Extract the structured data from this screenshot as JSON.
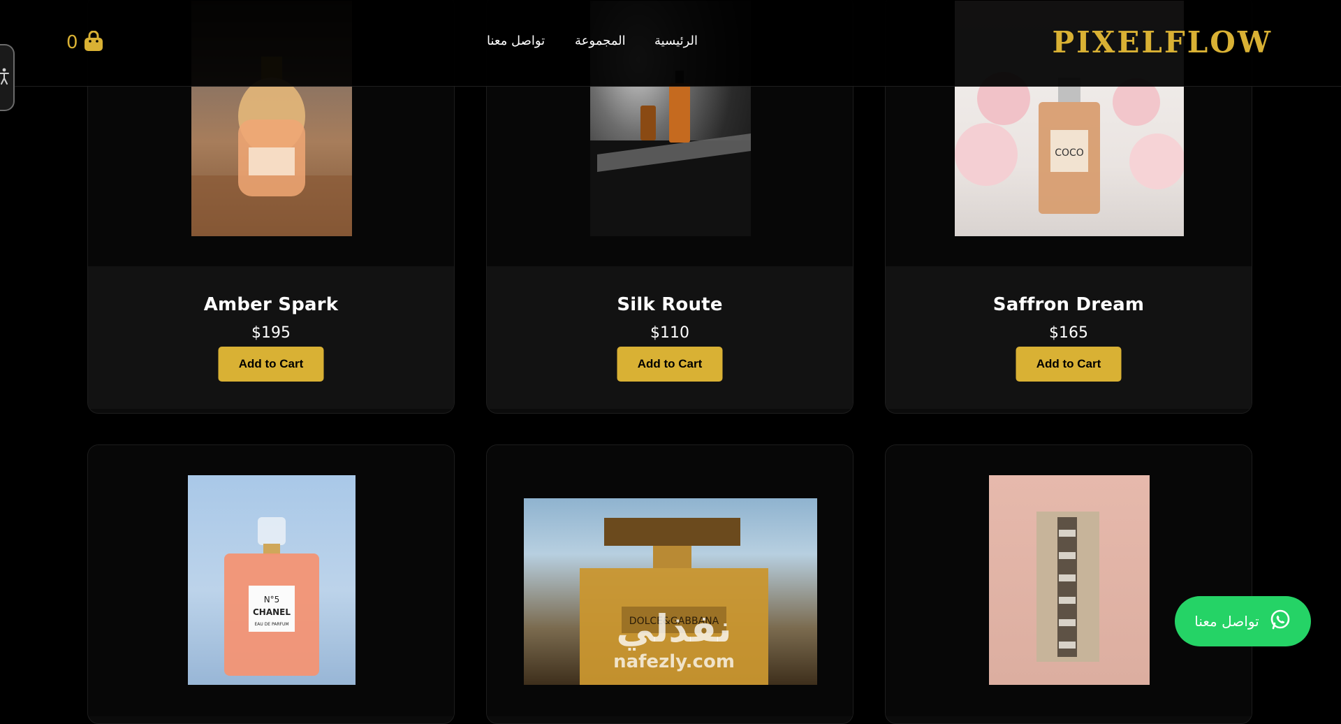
{
  "header": {
    "logo": "PIXELFLOW",
    "nav": [
      {
        "label": "الرئيسية"
      },
      {
        "label": "المجموعة"
      },
      {
        "label": "تواصل معنا"
      }
    ],
    "cart_count": "0"
  },
  "products": [
    {
      "name": "Amber Spark",
      "price": "$195",
      "button": "Add to Cart"
    },
    {
      "name": "Silk Route",
      "price": "$110",
      "button": "Add to Cart"
    },
    {
      "name": "Saffron Dream",
      "price": "$165",
      "button": "Add to Cart"
    },
    {
      "name": "",
      "price": "",
      "button": ""
    },
    {
      "name": "",
      "price": "",
      "button": ""
    },
    {
      "name": "",
      "price": "",
      "button": ""
    }
  ],
  "product_labels": {
    "coco_label": "COCO",
    "no5_line1": "N°5",
    "no5_line2": "CHANEL",
    "no5_line3": "EAU DE PARFUM",
    "dg_label": "DOLCE&GABBANA"
  },
  "whatsapp": {
    "label": "تواصل معنا",
    "color": "#25d366"
  },
  "watermark": {
    "arabic": "نفذلي",
    "latin": "nafezly.com"
  },
  "colors": {
    "accent": "#d9b134",
    "background": "#000000",
    "card": "#0b0b0b"
  },
  "icons": [
    "shopping-bag-icon",
    "accessibility-icon",
    "whatsapp-icon"
  ]
}
